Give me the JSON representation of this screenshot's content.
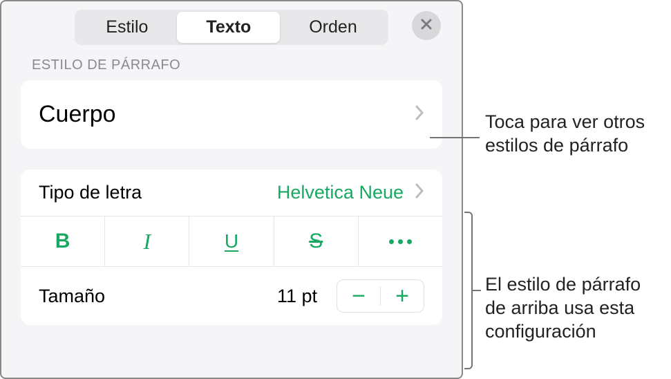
{
  "tabs": {
    "style": "Estilo",
    "text": "Texto",
    "order": "Orden"
  },
  "section": {
    "paragraph_style_label": "ESTILO DE PÁRRAFO"
  },
  "paragraph_style": {
    "current": "Cuerpo"
  },
  "font": {
    "label": "Tipo de letra",
    "value": "Helvetica Neue"
  },
  "format_buttons": {
    "bold": "B",
    "italic": "I",
    "underline": "U",
    "strike": "S"
  },
  "size": {
    "label": "Tamaño",
    "value": "11 pt"
  },
  "callouts": {
    "c1_l1": "Toca para ver otros",
    "c1_l2": "estilos de párrafo",
    "c2_l1": "El estilo de párrafo",
    "c2_l2": "de arriba usa esta",
    "c2_l3": "configuración"
  },
  "colors": {
    "accent": "#17a862"
  }
}
